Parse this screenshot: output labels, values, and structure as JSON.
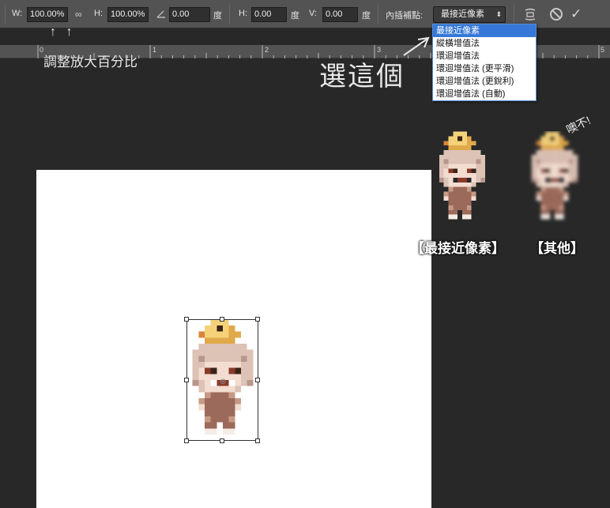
{
  "options_bar": {
    "width_label": "W:",
    "width_value": "100.00%",
    "height_label": "H:",
    "height_value": "100.00%",
    "angle_value": "0.00",
    "angle_unit": "度",
    "skew_h_label": "H:",
    "skew_h_value": "0.00",
    "skew_h_unit": "度",
    "skew_v_label": "V:",
    "skew_v_value": "0.00",
    "skew_v_unit": "度",
    "interpolation_label": "內插補點:",
    "interpolation_value": "最接近像素"
  },
  "interpolation_menu": {
    "options": [
      "最接近像素",
      "縱橫增值法",
      "環迴增值法",
      "環迴增值法 (更平滑)",
      "環迴增值法 (更銳利)",
      "環迴增值法 (自動)"
    ],
    "selected_index": 0
  },
  "ruler": {
    "labels": [
      "0",
      "1",
      "2",
      "3",
      "4",
      "5"
    ]
  },
  "annotations": {
    "zoom_arrows": "↑      ↑",
    "zoom_hint": "調整放大百分比",
    "pick_hint": "選這個",
    "oops": "噢不!",
    "caption_nearest": "【最接近像素】",
    "caption_other": "【其他】"
  },
  "colors": {
    "toolbar_bg": "#535353",
    "workspace_bg": "#282828",
    "canvas_bg": "#ffffff",
    "menu_highlight": "#3578d8"
  },
  "icons": {
    "link": "chain-link-icon",
    "angle": "angle-icon",
    "warp": "warp-mode-icon",
    "cancel": "cancel-icon",
    "commit": "check-icon"
  }
}
